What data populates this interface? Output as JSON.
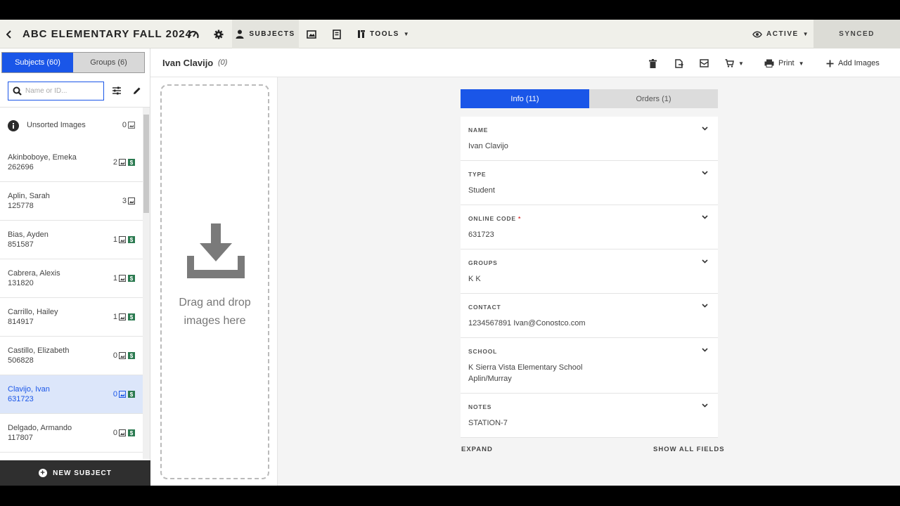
{
  "app": {
    "title": "ABC ELEMENTARY FALL 2024"
  },
  "nav": {
    "subjects_label": "SUBJECTS",
    "tools_label": "TOOLS",
    "status_label": "ACTIVE",
    "sync_label": "SYNCED"
  },
  "sidebar": {
    "tab_subjects": "Subjects (60)",
    "tab_groups": "Groups (6)",
    "search_placeholder": "Name or ID...",
    "unsorted": {
      "label": "Unsorted Images",
      "count": "0"
    },
    "subjects": [
      {
        "name": "Akinboboye, Emeka",
        "id": "262696",
        "count": "2",
        "paid": true,
        "selected": false
      },
      {
        "name": "Aplin, Sarah",
        "id": "125778",
        "count": "3",
        "paid": false,
        "selected": false
      },
      {
        "name": "Bias, Ayden",
        "id": "851587",
        "count": "1",
        "paid": true,
        "selected": false
      },
      {
        "name": "Cabrera, Alexis",
        "id": "131820",
        "count": "1",
        "paid": true,
        "selected": false
      },
      {
        "name": "Carrillo, Hailey",
        "id": "814917",
        "count": "1",
        "paid": true,
        "selected": false
      },
      {
        "name": "Castillo, Elizabeth",
        "id": "506828",
        "count": "0",
        "paid": true,
        "selected": false
      },
      {
        "name": "Clavijo, Ivan",
        "id": "631723",
        "count": "0",
        "paid": true,
        "selected": true
      },
      {
        "name": "Delgado, Armando",
        "id": "117807",
        "count": "0",
        "paid": true,
        "selected": false
      }
    ],
    "new_subject_label": "NEW SUBJECT"
  },
  "header": {
    "name": "Ivan Clavijo",
    "count": "(0)",
    "print_label": "Print",
    "add_images_label": "Add Images"
  },
  "dropzone": {
    "line1": "Drag and drop",
    "line2": "images here"
  },
  "tabs": {
    "info": "Info (11)",
    "orders": "Orders (1)"
  },
  "fields": [
    {
      "label": "NAME",
      "required": false,
      "lines": [
        "Ivan Clavijo"
      ]
    },
    {
      "label": "TYPE",
      "required": false,
      "lines": [
        "Student"
      ]
    },
    {
      "label": "ONLINE CODE",
      "required": true,
      "lines": [
        "631723"
      ]
    },
    {
      "label": "GROUPS",
      "required": false,
      "lines": [
        "K   K"
      ]
    },
    {
      "label": "CONTACT",
      "required": false,
      "lines": [
        "1234567891   Ivan@Conostco.com"
      ]
    },
    {
      "label": "SCHOOL",
      "required": false,
      "lines": [
        "K   Sierra Vista Elementary School",
        "Aplin/Murray"
      ]
    },
    {
      "label": "NOTES",
      "required": false,
      "lines": [
        "STATION-7"
      ]
    }
  ],
  "footer_links": {
    "expand": "EXPAND",
    "show_all": "SHOW ALL FIELDS"
  },
  "colors": {
    "accent": "#1a56e8",
    "paid": "#2b7a50",
    "required": "#dd3333"
  }
}
